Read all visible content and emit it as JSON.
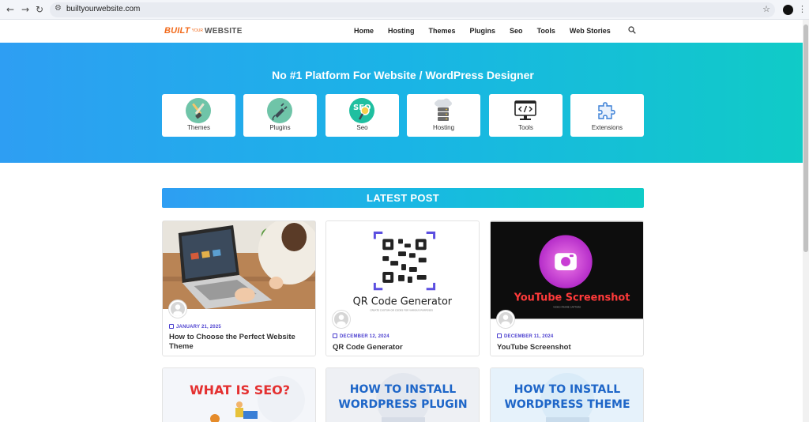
{
  "browser": {
    "url": "builtyourwebsite.com",
    "back_glyph": "←",
    "forward_glyph": "→",
    "reload_glyph": "↻",
    "star_glyph": "☆",
    "menu_glyph": "⋮",
    "site_info_glyph": "⚙"
  },
  "site": {
    "logo": {
      "built": "BUILT",
      "your": "YOUR",
      "website": "WEBSITE"
    },
    "menu": [
      "Home",
      "Hosting",
      "Themes",
      "Plugins",
      "Seo",
      "Tools",
      "Web Stories"
    ]
  },
  "hero": {
    "title": "No #1 Platform For Website / WordPress Designer",
    "categories": [
      {
        "label": "Themes",
        "icon": "paintbrush-icon"
      },
      {
        "label": "Plugins",
        "icon": "plug-icon"
      },
      {
        "label": "Seo",
        "icon": "seo-magnifier-icon"
      },
      {
        "label": "Hosting",
        "icon": "server-cloud-icon"
      },
      {
        "label": "Tools",
        "icon": "code-monitor-icon"
      },
      {
        "label": "Extensions",
        "icon": "puzzle-icon"
      }
    ]
  },
  "latest": {
    "heading": "LATEST POST",
    "posts": [
      {
        "date": "JANUARY 21, 2025",
        "title": "How to Choose the Perfect Website Theme"
      },
      {
        "date": "DECEMBER 12, 2024",
        "title": "QR Code Generator",
        "image_text": "QR Code Generator",
        "image_sub": "CREATE CUSTOM QR CODES FOR VARIOUS PURPOSES"
      },
      {
        "date": "DECEMBER 11, 2024",
        "title": "YouTube Screenshot",
        "image_text": "YouTube Screenshot",
        "image_sub": "VIDEO FRAME CAPTURE"
      }
    ],
    "more": [
      {
        "image_text": "WHAT IS SEO?"
      },
      {
        "image_text_1": "HOW TO INSTALL",
        "image_text_2": "WORDPRESS PLUGIN"
      },
      {
        "image_text_1": "HOW TO INSTALL",
        "image_text_2": "WORDPRESS THEME"
      }
    ]
  },
  "colors": {
    "accent": "#4b3fcf",
    "gradient_start": "#2e9ef3",
    "gradient_end": "#10cbc7",
    "logo_orange": "#f26a1b"
  }
}
